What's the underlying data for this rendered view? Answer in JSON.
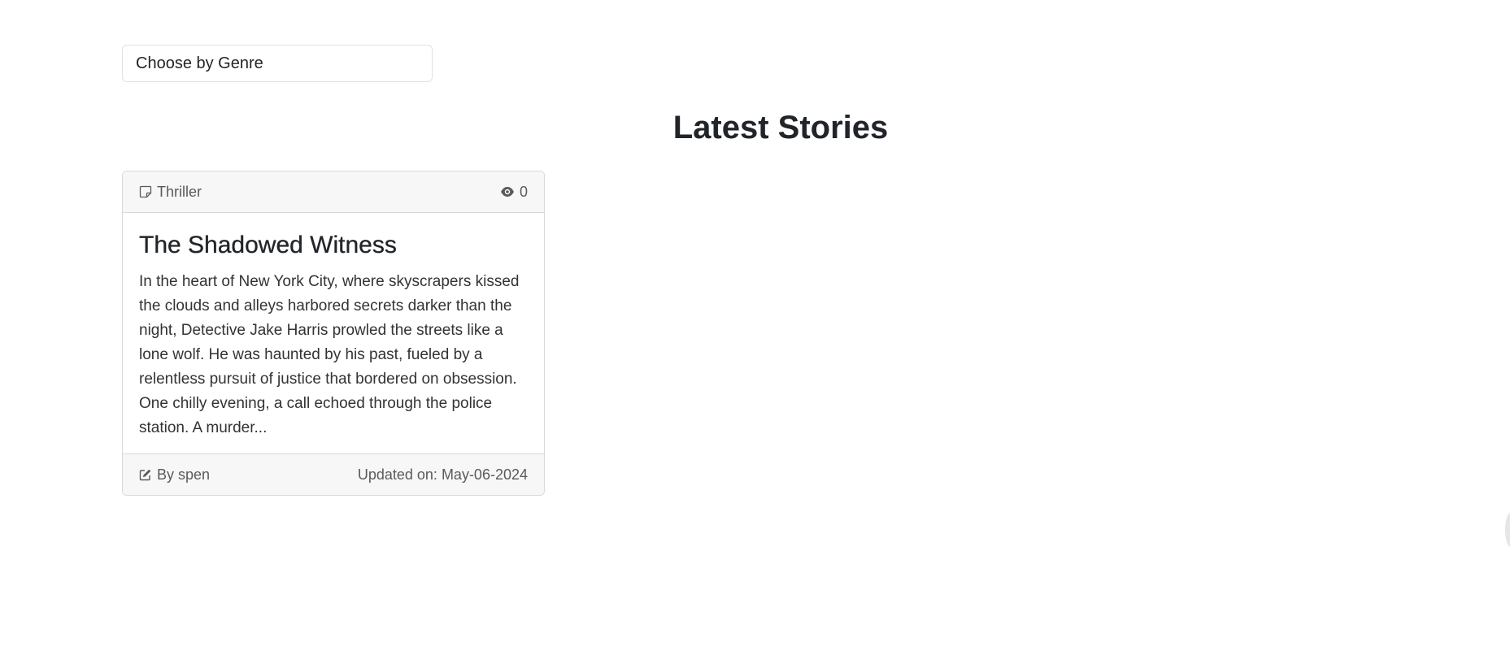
{
  "filter": {
    "genre_placeholder": "Choose by Genre"
  },
  "section": {
    "title": "Latest Stories"
  },
  "stories": [
    {
      "genre": "Thriller",
      "views": "0",
      "title": "The Shadowed Witness",
      "excerpt": "In the heart of New York City, where skyscrapers kissed the clouds and alleys harbored secrets darker than the night, Detective Jake Harris prowled the streets like a lone wolf. He was haunted by his past, fueled by a relentless pursuit of justice that bordered on obsession. One chilly evening, a call echoed through the police station. A murder...",
      "author": "By spen",
      "updated": "Updated on: May-06-2024",
      "icons": {
        "genre": "sticky-note-icon",
        "views": "eye-icon",
        "author": "pencil-square-icon"
      }
    }
  ],
  "colors": {
    "header_bg": "#f7f7f7",
    "border": "#d9d9d9",
    "text": "#212529",
    "muted": "#5a5a5a"
  }
}
